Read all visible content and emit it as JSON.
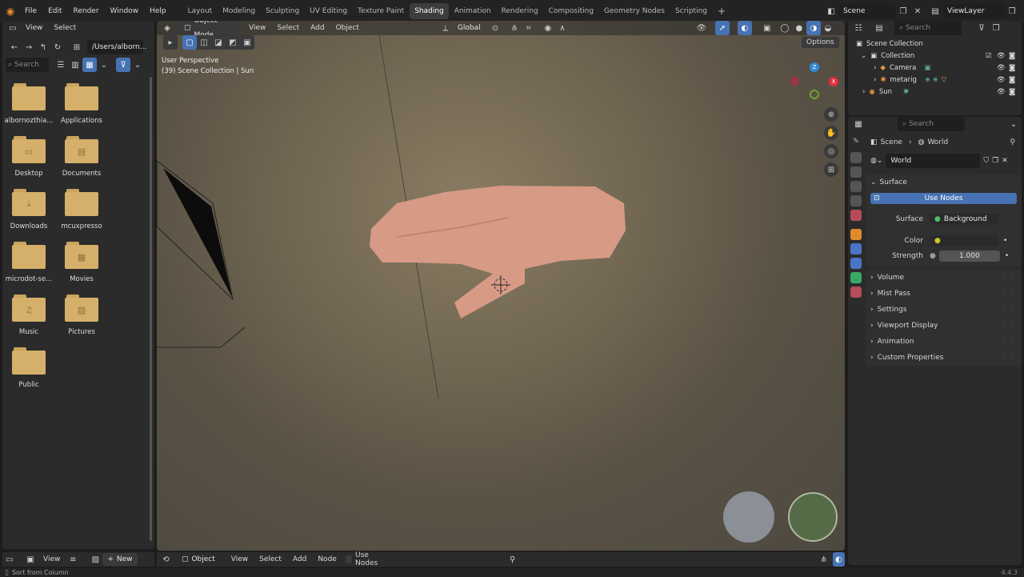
{
  "app": {
    "menus": [
      "File",
      "Edit",
      "Render",
      "Window",
      "Help"
    ],
    "workspaces": [
      "Layout",
      "Modeling",
      "Sculpting",
      "UV Editing",
      "Texture Paint",
      "Shading",
      "Animation",
      "Rendering",
      "Compositing",
      "Geometry Nodes",
      "Scripting"
    ],
    "active_workspace": "Shading",
    "add_tab": "+",
    "scene": "Scene",
    "view_layer": "ViewLayer"
  },
  "file_browser": {
    "menus": [
      "View",
      "Select"
    ],
    "path": "/Users/alborn...",
    "search_placeholder": "Search",
    "folders": [
      {
        "name": "albornozthia...",
        "glyph": ""
      },
      {
        "name": "Applications",
        "glyph": ""
      },
      {
        "name": "Desktop",
        "glyph": "▭"
      },
      {
        "name": "Documents",
        "glyph": "▤"
      },
      {
        "name": "Downloads",
        "glyph": "⤓"
      },
      {
        "name": "mcuxpresso",
        "glyph": ""
      },
      {
        "name": "microdot-se...",
        "glyph": ""
      },
      {
        "name": "Movies",
        "glyph": "▦"
      },
      {
        "name": "Music",
        "glyph": "♫"
      },
      {
        "name": "Pictures",
        "glyph": "▨"
      },
      {
        "name": "Public",
        "glyph": ""
      }
    ]
  },
  "viewport": {
    "mode": "Object Mode",
    "menus": [
      "View",
      "Select",
      "Add",
      "Object"
    ],
    "orientation": "Global",
    "options": "Options",
    "info_line1": "User Perspective",
    "info_line2": "(39) Scene Collection | Sun",
    "axes": {
      "z": "Z",
      "x": "X"
    }
  },
  "outliner": {
    "search_placeholder": "Search",
    "items": [
      {
        "label": "Scene Collection"
      },
      {
        "label": "Collection"
      },
      {
        "label": "Camera"
      },
      {
        "label": "metarig"
      },
      {
        "label": "Sun"
      }
    ]
  },
  "properties": {
    "search_placeholder": "Search",
    "breadcrumb": {
      "scene": "Scene",
      "sep": "›",
      "world": "World"
    },
    "world_name": "World",
    "sections": {
      "surface": "Surface",
      "use_nodes": "Use Nodes",
      "surface_label": "Surface",
      "surface_value": "Background",
      "color_label": "Color",
      "strength_label": "Strength",
      "strength_value": "1.000"
    },
    "collapsed": [
      "Volume",
      "Mist Pass",
      "Settings",
      "Viewport Display",
      "Animation",
      "Custom Properties"
    ]
  },
  "bottom_bars": {
    "left_view": "View",
    "new": "New",
    "node_object": "Object",
    "node_menus": [
      "View",
      "Select",
      "Add",
      "Node"
    ],
    "use_nodes": "Use Nodes"
  },
  "status": {
    "left": "Sort from Column",
    "version": "4.4.3"
  },
  "colors": {
    "accent": "#4772b3",
    "folder": "#d4b06a",
    "axis_x": "#e0303d",
    "axis_y": "#6fa32d",
    "axis_z": "#2f8ad8"
  }
}
